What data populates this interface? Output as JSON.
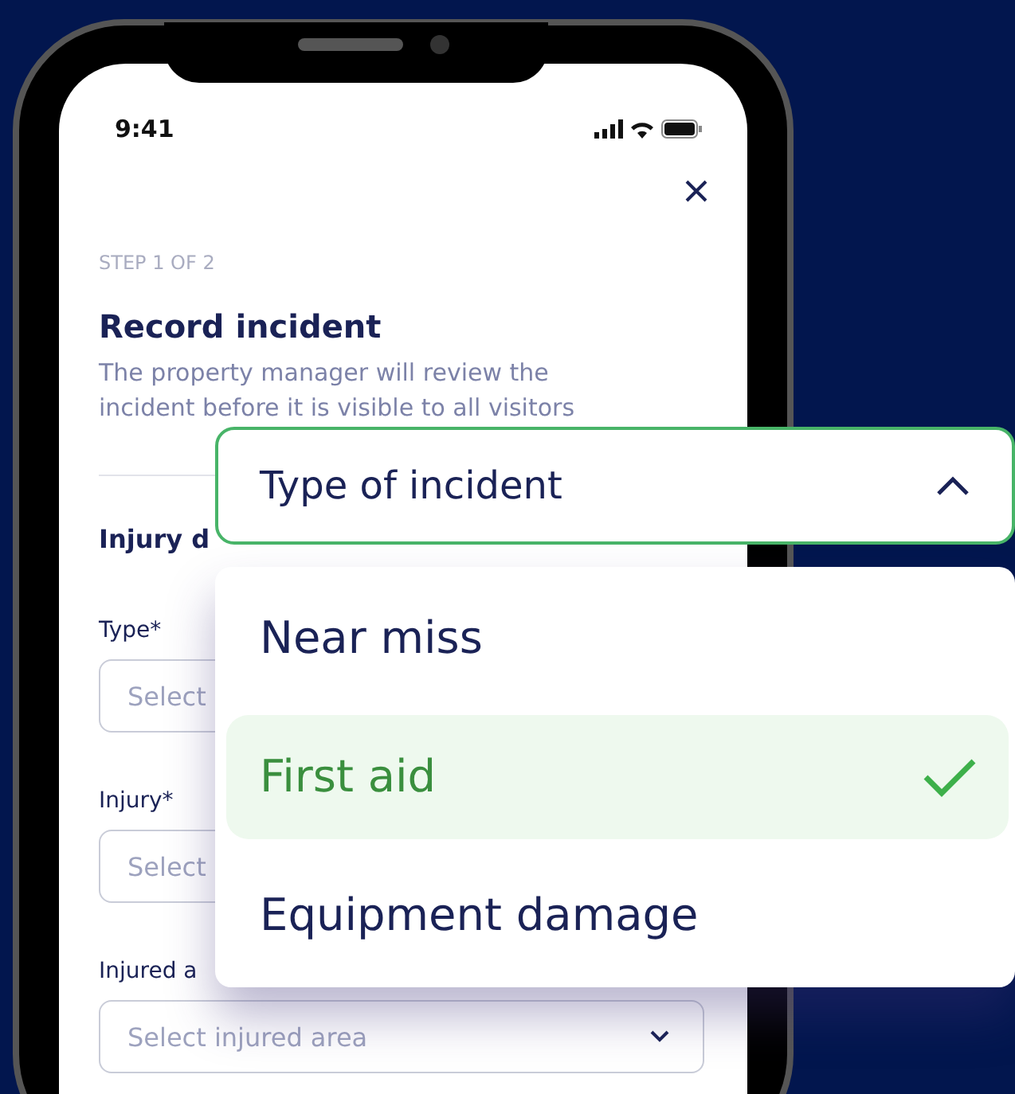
{
  "status_bar": {
    "time": "9:41"
  },
  "form": {
    "step": "STEP 1 OF 2",
    "title": "Record incident",
    "description": "The property manager will review the incident before it is visible to all visitors",
    "section": "Injury d",
    "fields": [
      {
        "label": "Type*",
        "placeholder": "Select"
      },
      {
        "label": "Injury*",
        "placeholder": "Select"
      },
      {
        "label": "Injured a",
        "placeholder": "Select injured area"
      }
    ]
  },
  "dropdown": {
    "label": "Type of incident",
    "expanded": true,
    "options": [
      {
        "label": "Near miss",
        "selected": false
      },
      {
        "label": "First aid",
        "selected": true
      },
      {
        "label": "Equipment damage",
        "selected": false
      }
    ]
  }
}
